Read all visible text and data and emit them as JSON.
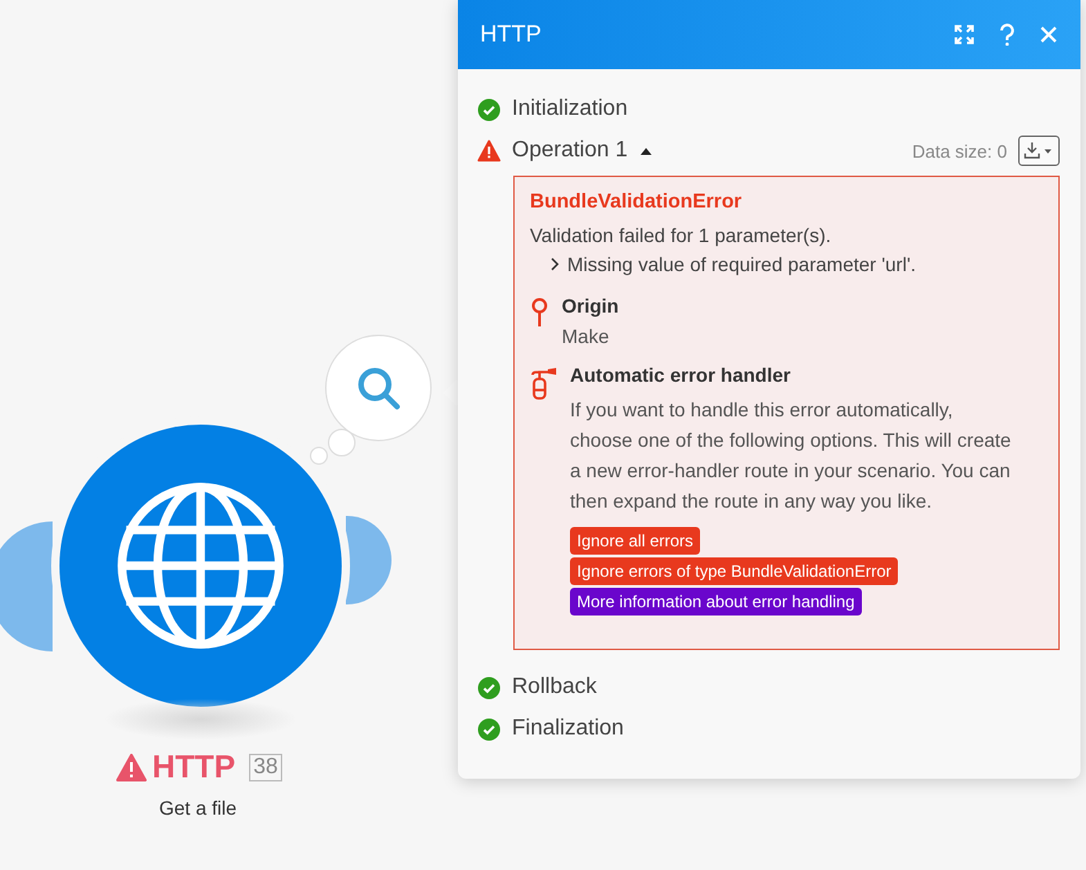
{
  "module": {
    "name": "HTTP",
    "warning": true,
    "count": "38",
    "action": "Get a file"
  },
  "panel": {
    "title": "HTTP",
    "steps": [
      {
        "label": "Initialization",
        "kind": "success"
      },
      {
        "label": "Operation 1",
        "kind": "error",
        "expanded": true,
        "data_size": "Data size: 0",
        "error": {
          "title": "BundleValidationError",
          "message": "Validation failed for 1 parameter(s).",
          "details": [
            "Missing value of required parameter 'url'."
          ],
          "origin_label": "Origin",
          "origin": "Make",
          "handler_title": "Automatic error handler",
          "handler_text": "If you want to handle this error automatically, choose one of the following options. This will create a new error-handler route in your scenario. You can then expand the route in any way you like.",
          "actions": [
            {
              "label": "Ignore all errors",
              "color": "#e8391e"
            },
            {
              "label": "Ignore errors of type BundleValidationError",
              "color": "#e8391e"
            },
            {
              "label": "More information about error handling",
              "color": "#6a06cc"
            }
          ]
        }
      },
      {
        "label": "Rollback",
        "kind": "success"
      },
      {
        "label": "Finalization",
        "kind": "success"
      }
    ]
  }
}
